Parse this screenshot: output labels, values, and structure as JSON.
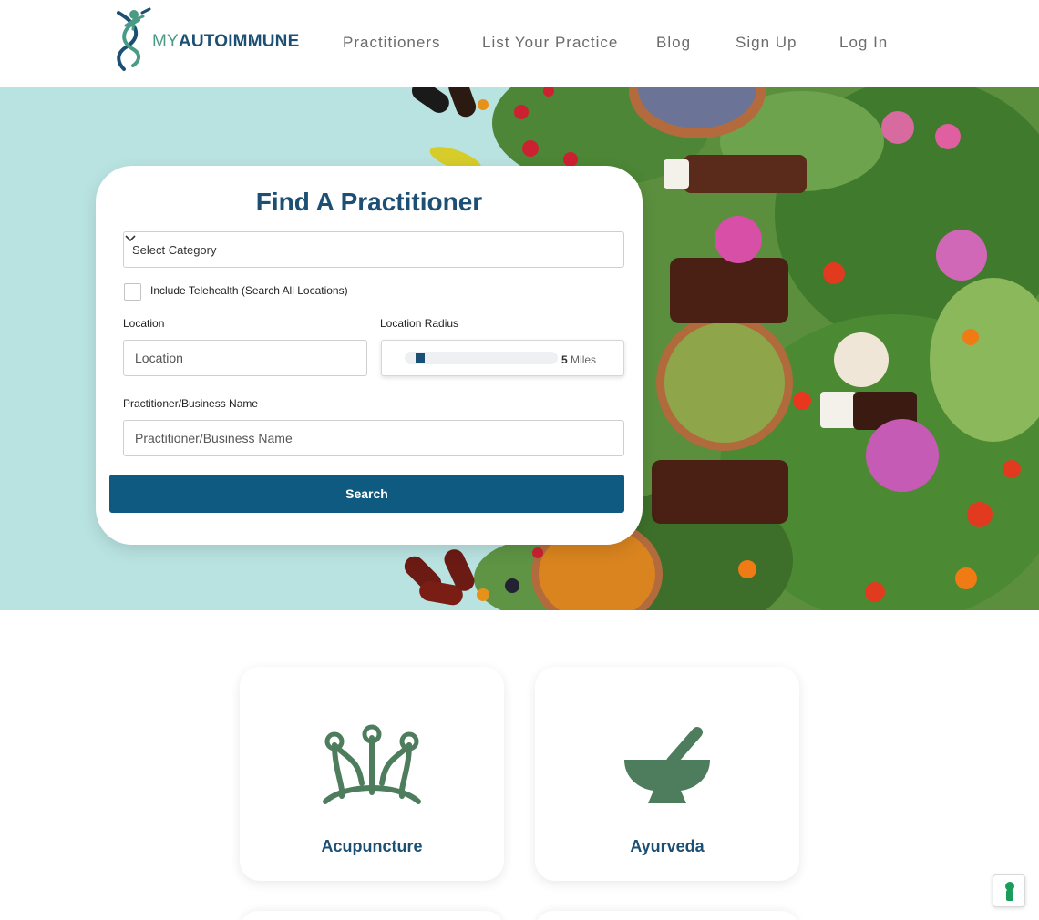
{
  "header": {
    "logo_my": "MY",
    "logo_rest": "AUTOIMMUNE",
    "nav": [
      {
        "label": "Practitioners"
      },
      {
        "label": "List Your Practice"
      },
      {
        "label": "Blog"
      },
      {
        "label": "Sign Up"
      },
      {
        "label": "Log In"
      }
    ]
  },
  "search": {
    "title": "Find A Practitioner",
    "category_select": "Select Category",
    "telehealth_label": "Include Telehealth (Search All Locations)",
    "telehealth_checked": false,
    "location_label": "Location",
    "location_placeholder": "Location",
    "radius_label": "Location Radius",
    "radius_value": "5",
    "radius_unit": "Miles",
    "name_label": "Practitioner/Business Name",
    "name_placeholder": "Practitioner/Business Name",
    "search_button": "Search"
  },
  "categories": [
    {
      "label": "Acupuncture",
      "icon": "acupuncture-needles-icon"
    },
    {
      "label": "Ayurveda",
      "icon": "mortar-pestle-icon"
    }
  ],
  "colors": {
    "brand_navy": "#1b4f73",
    "brand_green": "#4a9b86",
    "button_blue": "#0f5a80",
    "icon_green": "#4e7d5e",
    "hero_bg": "#b9e3e1"
  },
  "accessibility": {
    "icon": "accessibility-icon"
  }
}
